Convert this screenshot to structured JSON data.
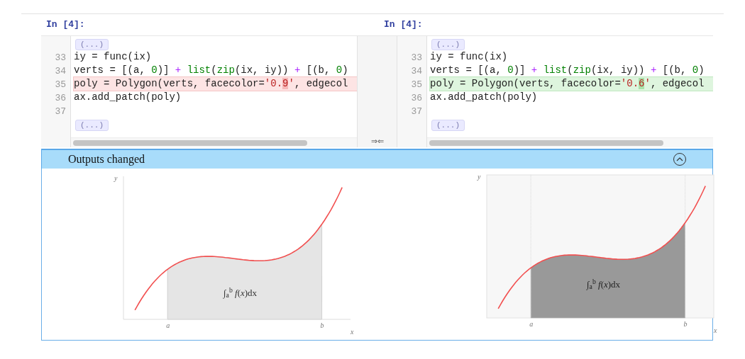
{
  "cells": [
    {
      "prompt": "In [4]:",
      "fold_markers": [
        "(...)",
        "(...)"
      ],
      "lines": [
        {
          "number": "33",
          "tokens": [
            {
              "text": "iy = func(ix)",
              "kind": "plain"
            }
          ]
        },
        {
          "number": "34",
          "tokens": [
            {
              "text": "verts = [(a, ",
              "kind": "plain"
            },
            {
              "text": "0",
              "kind": "number"
            },
            {
              "text": ")]",
              "kind": "plain"
            },
            {
              "text": " + ",
              "kind": "operator"
            },
            {
              "text": "list",
              "kind": "builtin"
            },
            {
              "text": "(",
              "kind": "plain"
            },
            {
              "text": "zip",
              "kind": "builtin"
            },
            {
              "text": "(ix, iy))",
              "kind": "plain"
            },
            {
              "text": " + ",
              "kind": "operator"
            },
            {
              "text": "[(b, ",
              "kind": "plain"
            },
            {
              "text": "0",
              "kind": "number"
            },
            {
              "text": ")",
              "kind": "plain"
            }
          ]
        },
        {
          "number": "35",
          "removed": true,
          "tokens": [
            {
              "text": "poly = Polygon(verts, facecolor=",
              "kind": "plain"
            },
            {
              "text": "'0.",
              "kind": "string"
            },
            {
              "text": "9",
              "kind": "string",
              "changed": true
            },
            {
              "text": "'",
              "kind": "string"
            },
            {
              "text": ", edgecol",
              "kind": "plain"
            }
          ]
        },
        {
          "number": "36",
          "tokens": [
            {
              "text": "ax.add_patch(poly)",
              "kind": "plain"
            }
          ]
        },
        {
          "number": "37"
        }
      ]
    },
    {
      "prompt": "In [4]:",
      "fold_markers": [
        "(...)",
        "(...)"
      ],
      "lines": [
        {
          "number": "33",
          "tokens": [
            {
              "text": "iy = func(ix)",
              "kind": "plain"
            }
          ]
        },
        {
          "number": "34",
          "tokens": [
            {
              "text": "verts = [(a, ",
              "kind": "plain"
            },
            {
              "text": "0",
              "kind": "number"
            },
            {
              "text": ")]",
              "kind": "plain"
            },
            {
              "text": " + ",
              "kind": "operator"
            },
            {
              "text": "list",
              "kind": "builtin"
            },
            {
              "text": "(",
              "kind": "plain"
            },
            {
              "text": "zip",
              "kind": "builtin"
            },
            {
              "text": "(ix, iy))",
              "kind": "plain"
            },
            {
              "text": " + ",
              "kind": "operator"
            },
            {
              "text": "[(b, ",
              "kind": "plain"
            },
            {
              "text": "0",
              "kind": "number"
            },
            {
              "text": ")",
              "kind": "plain"
            }
          ]
        },
        {
          "number": "35",
          "added": true,
          "tokens": [
            {
              "text": "poly = Polygon(verts, facecolor=",
              "kind": "plain"
            },
            {
              "text": "'0.",
              "kind": "string"
            },
            {
              "text": "6",
              "kind": "string",
              "changed": true
            },
            {
              "text": "'",
              "kind": "string"
            },
            {
              "text": ", edgecol",
              "kind": "plain"
            }
          ]
        },
        {
          "number": "36",
          "tokens": [
            {
              "text": "ax.add_patch(poly)",
              "kind": "plain"
            }
          ]
        },
        {
          "number": "37"
        }
      ]
    }
  ],
  "merge_icon": "⇒⇐",
  "outputs": {
    "header": "Outputs changed",
    "expanded": true,
    "plots": [
      {
        "kind": "plain",
        "color": "#e5e5e5",
        "y_label": "y",
        "x_label": "x",
        "tick_labels": [
          "a",
          "b"
        ],
        "formula": "∫$_{a}$$^{b}$ *f*(*x*)dx"
      },
      {
        "kind": "grid",
        "color": "#999999",
        "y_label": "y",
        "x_label": "x",
        "tick_labels": [
          "a",
          "b"
        ],
        "formula": "∫$_{a}$$^{b}$ *f*(*x*)dx"
      }
    ]
  }
}
